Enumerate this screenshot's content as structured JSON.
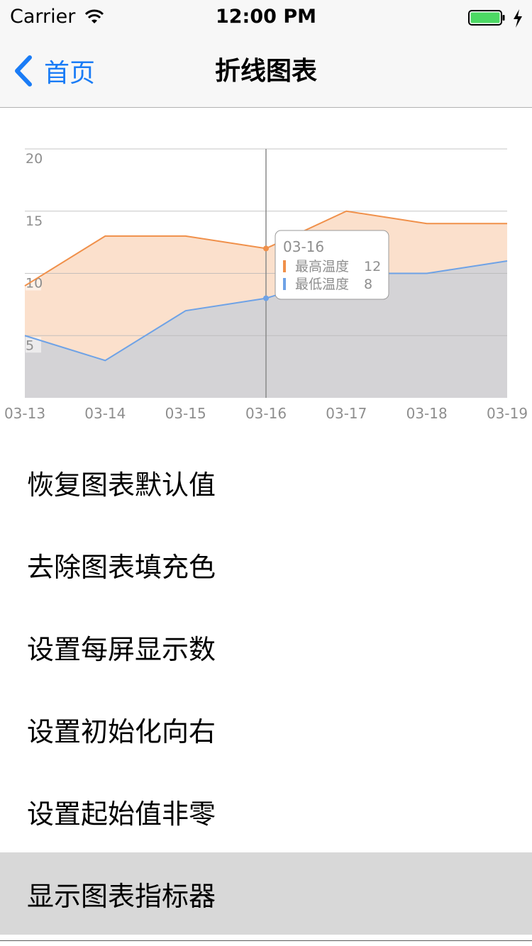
{
  "status_bar": {
    "carrier": "Carrier",
    "time": "12:00 PM"
  },
  "nav": {
    "back_label": "首页",
    "title": "折线图表"
  },
  "colors": {
    "accent": "#1a7cf6",
    "high_series": "#f0904a",
    "low_series": "#6ea2e6",
    "high_fill": "#fbe0cc",
    "low_fill": "#d4d3d6",
    "selected_row": "#d8d8d8"
  },
  "chart_data": {
    "type": "area",
    "x": [
      "03-13",
      "03-14",
      "03-15",
      "03-16",
      "03-17",
      "03-18",
      "03-19"
    ],
    "series": [
      {
        "name": "最高温度",
        "values": [
          9,
          13,
          13,
          12,
          15,
          14,
          14
        ]
      },
      {
        "name": "最低温度",
        "values": [
          5,
          3,
          7,
          8,
          10,
          10,
          11
        ]
      }
    ],
    "ylim": [
      0,
      20
    ],
    "y_ticks": [
      "5",
      "10",
      "15",
      "20"
    ],
    "grid": true,
    "crosshair_x": "03-16",
    "tooltip": {
      "title": "03-16",
      "rows": [
        {
          "name": "最高温度",
          "value": "12"
        },
        {
          "name": "最低温度",
          "value": "8"
        }
      ]
    }
  },
  "menu": [
    {
      "label": "恢复图表默认值",
      "selected": false
    },
    {
      "label": "去除图表填充色",
      "selected": false
    },
    {
      "label": "设置每屏显示数",
      "selected": false
    },
    {
      "label": "设置初始化向右",
      "selected": false
    },
    {
      "label": "设置起始值非零",
      "selected": false
    },
    {
      "label": "显示图表指标器",
      "selected": true
    }
  ]
}
